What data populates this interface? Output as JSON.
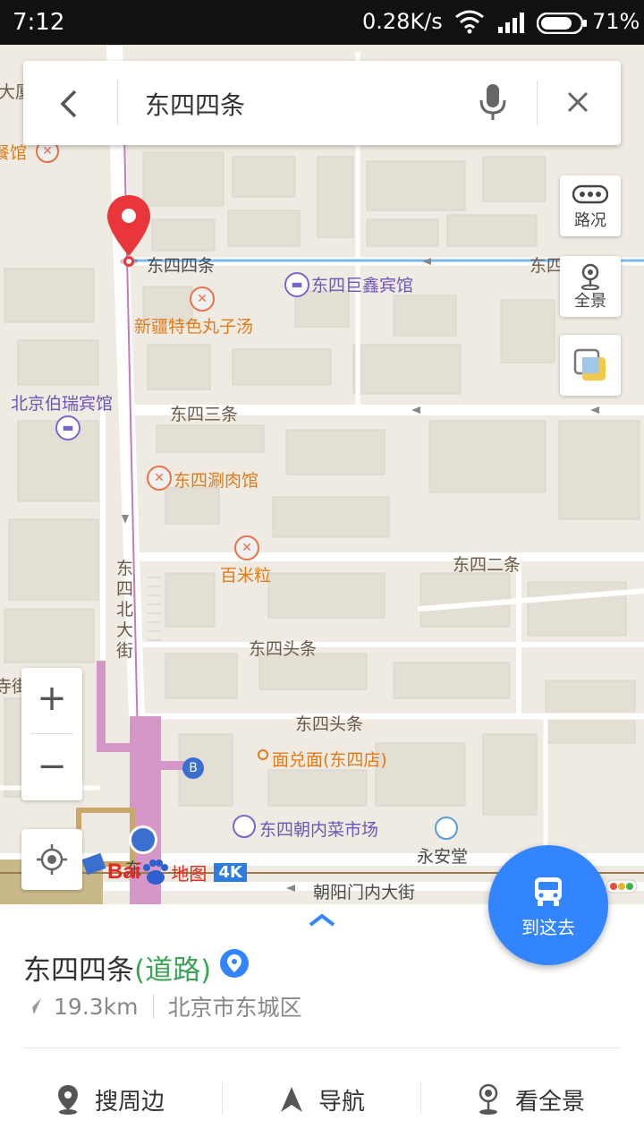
{
  "status_bar": {
    "time": "7:12",
    "net_speed": "0.28K/s",
    "battery": "71%"
  },
  "search": {
    "query": "东四四条"
  },
  "map": {
    "pin_label": "东四四条",
    "labels": {
      "dasha": "大厦",
      "canguan": "餐馆",
      "dongsi_right": "东四四条",
      "dongsi_hotel": "东四巨鑫宾馆",
      "xinjiang": "新疆特色丸子汤",
      "beijing_hotel": "北京伯瑞宾馆",
      "dongsi_santiao": "东四三条",
      "shuanrou": "东四涮肉馆",
      "baimili": "百米粒",
      "dongsi_ertiao": "东四二条",
      "dongsi_toutiao_1": "东四头条",
      "dongsi_toutiao_2": "东四头条",
      "dongsi_beidajie": "东四北大街",
      "si_jie": "寺街",
      "miandui": "面兑面(东四店)",
      "caishichang": "东四朝内菜市场",
      "yonganting": "永安堂",
      "chaoyangmen": "朝阳门内大街",
      "metro_b": "B",
      "east_partial": "东"
    },
    "logo_text": "地图",
    "logo_badge": "4K"
  },
  "controls": {
    "traffic_label": "路况",
    "panorama_label": "全景",
    "zoom_in": "+",
    "zoom_out": "−",
    "route_label": "到这去"
  },
  "place": {
    "name": "东四四条",
    "type": "(道路)",
    "distance": "19.3km",
    "district": "北京市东城区"
  },
  "actions": {
    "nearby": "搜周边",
    "navigate": "导航",
    "panorama": "看全景"
  }
}
